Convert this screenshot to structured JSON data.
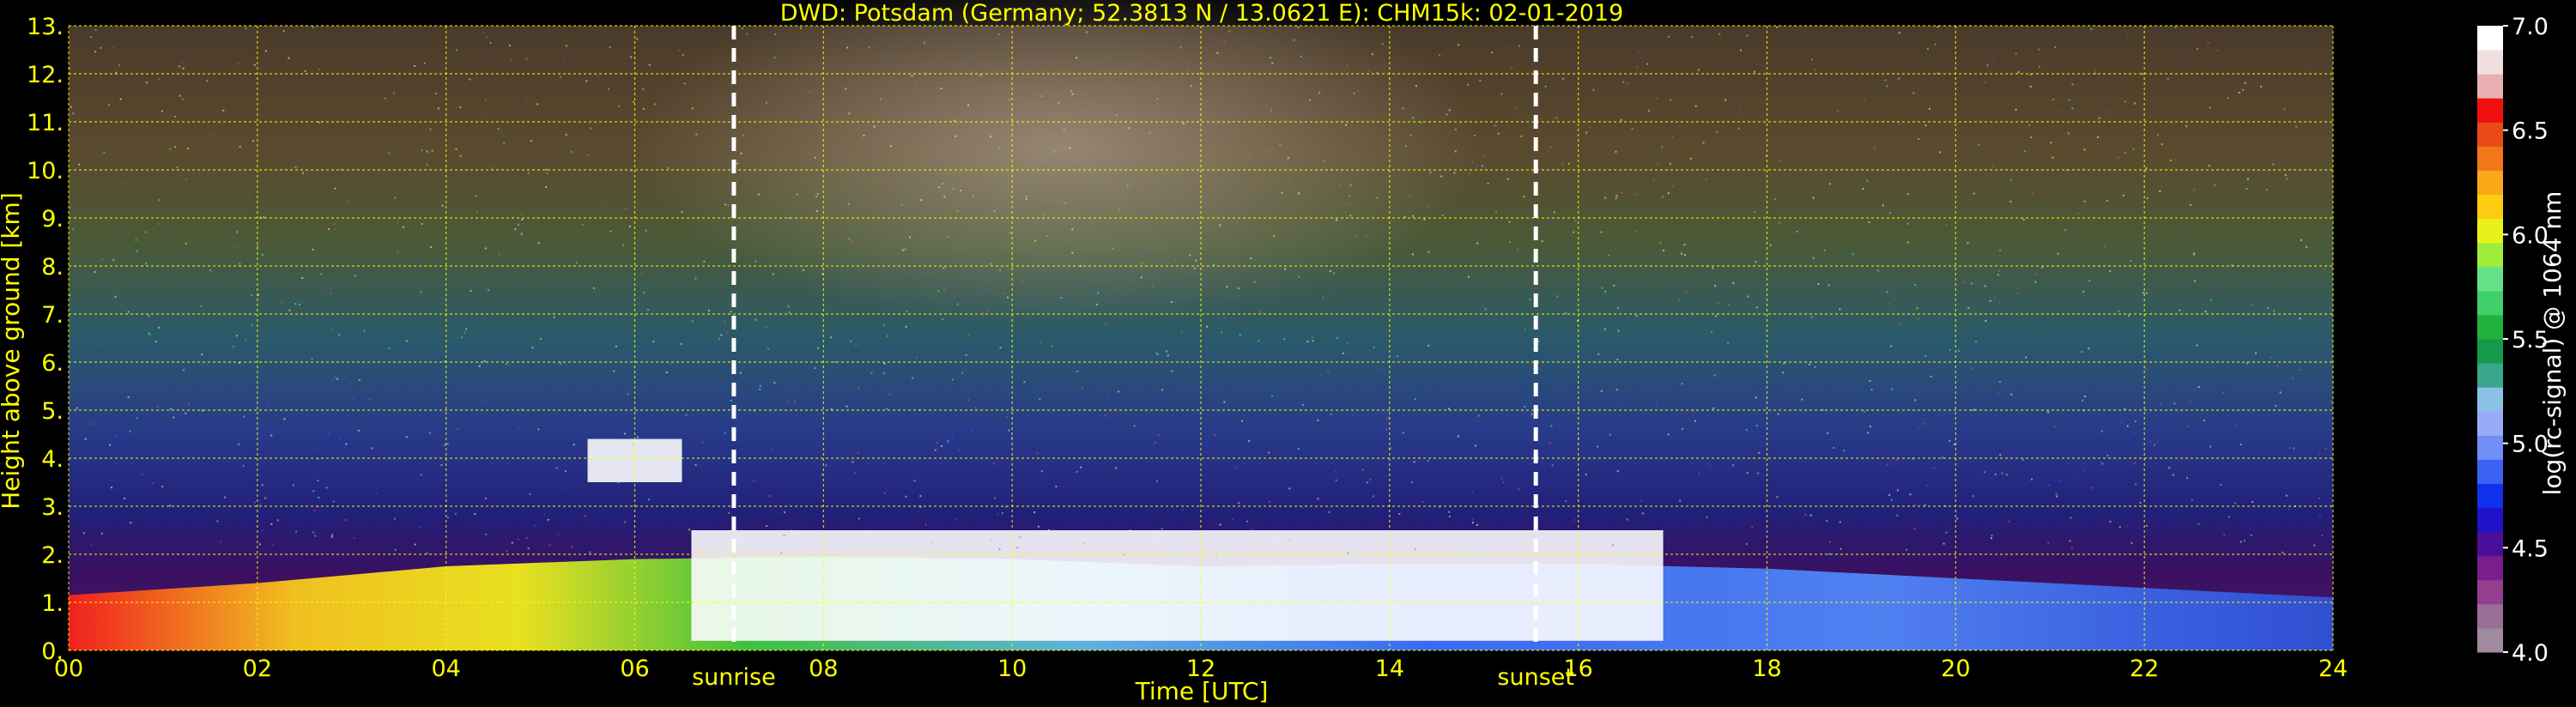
{
  "chart_data": {
    "type": "heatmap",
    "title": "DWD: Potsdam (Germany; 52.3813 N / 13.0621 E):    CHM15k: 02-01-2019",
    "xlabel": "Time [UTC]",
    "ylabel": "Height above ground [km]",
    "xlim": [
      0,
      24
    ],
    "ylim": [
      0,
      13
    ],
    "x_ticks": [
      "00",
      "02",
      "04",
      "06",
      "08",
      "10",
      "12",
      "14",
      "16",
      "18",
      "20",
      "22",
      "24"
    ],
    "y_ticks": [
      "0.",
      "1.",
      "2.",
      "3.",
      "4.",
      "5.",
      "6.",
      "7.",
      "8.",
      "9.",
      "10.",
      "11.",
      "12.",
      "13."
    ],
    "grid": true,
    "annotations": [
      {
        "label": "sunrise",
        "x": 7.05
      },
      {
        "label": "sunset",
        "x": 15.55
      }
    ],
    "colorbar": {
      "label": "log(rc-signal) @ 1064 nm",
      "range": [
        4.0,
        7.0
      ],
      "ticks": [
        "4.0",
        "4.5",
        "5.0",
        "5.5",
        "6.0",
        "6.5",
        "7.0"
      ],
      "colors": [
        "#a08aa0",
        "#9a6f97",
        "#923f8f",
        "#7a1e8c",
        "#4a0f9a",
        "#1f12c8",
        "#1030ee",
        "#3a63f4",
        "#6f8ff6",
        "#98abf7",
        "#8cc0e6",
        "#3aa68a",
        "#149a4a",
        "#20b23a",
        "#3fd06a",
        "#67e08a",
        "#a0ec3a",
        "#e8f21a",
        "#fbcc10",
        "#f9a818",
        "#f07818",
        "#e84a18",
        "#f01010",
        "#e8b0b0",
        "#f0e0e0",
        "#ffffff"
      ]
    },
    "layers": [
      {
        "name": "aerosol_boundary_layer",
        "x": [
          0,
          2,
          4,
          6,
          8,
          10,
          12,
          14,
          16,
          18,
          20,
          22,
          24
        ],
        "top_km": [
          1.15,
          1.4,
          1.75,
          1.9,
          1.95,
          1.9,
          1.75,
          1.8,
          1.8,
          1.7,
          1.5,
          1.3,
          1.1
        ]
      },
      {
        "name": "cloud_layer",
        "x": [
          5.5,
          6.5
        ],
        "base_km": 3.5,
        "top_km": 4.4
      },
      {
        "name": "cloud_layer",
        "x": [
          6.6,
          16.9
        ],
        "base_km": 0.2,
        "top_km": 2.5
      }
    ]
  }
}
